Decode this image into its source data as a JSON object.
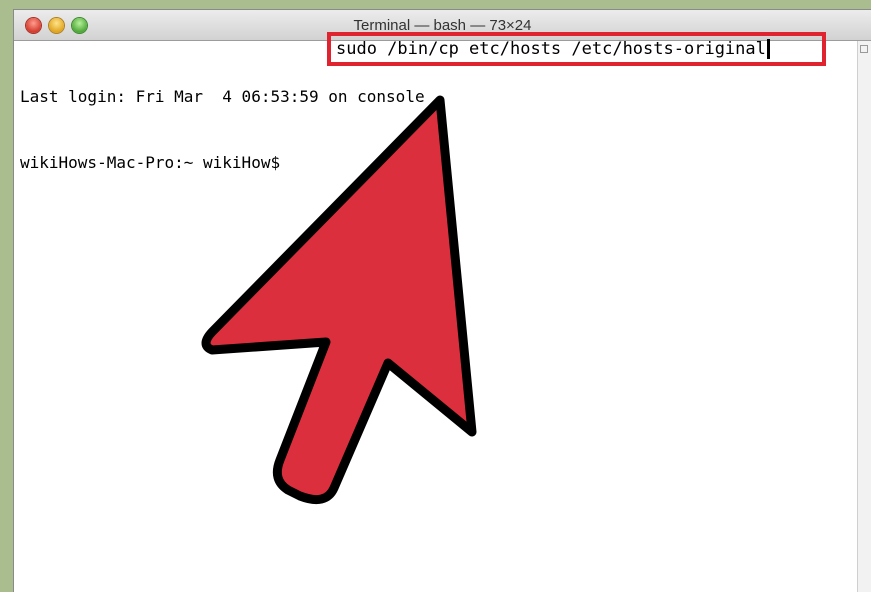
{
  "window": {
    "title": "Terminal — bash — 73×24"
  },
  "terminal": {
    "line1": "Last login: Fri Mar  4 06:53:59 on console",
    "prompt": "wikiHows-Mac-Pro:~ wikiHow$ ",
    "command": "sudo /bin/cp etc/hosts /etc/hosts-original"
  },
  "annotation": {
    "highlight_color": "#e0242f",
    "arrow_fill": "#dc2f3d",
    "arrow_stroke": "#000000",
    "icon": "arrow-pointer-icon"
  }
}
